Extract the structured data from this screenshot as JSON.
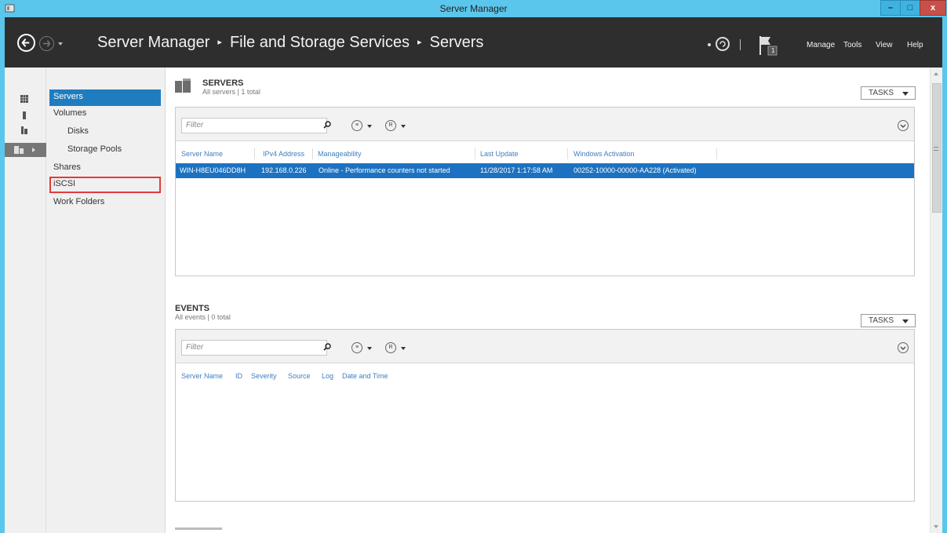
{
  "window": {
    "title": "Server Manager",
    "min_label": "–",
    "max_label": "□",
    "close_label": "x"
  },
  "header": {
    "breadcrumb": [
      "Server Manager",
      "File and Storage Services",
      "Servers"
    ],
    "separator": "▸",
    "menu": [
      "Manage",
      "Tools",
      "View",
      "Help"
    ],
    "notification_count": "1"
  },
  "sidebar": {
    "items": [
      {
        "label": "Servers",
        "state": "active"
      },
      {
        "label": "Volumes"
      },
      {
        "label": "Disks",
        "indent": true
      },
      {
        "label": "Storage Pools",
        "indent": true
      },
      {
        "label": "Shares"
      },
      {
        "label": "iSCSI",
        "state": "highlighted"
      },
      {
        "label": "Work Folders"
      }
    ]
  },
  "servers": {
    "title": "SERVERS",
    "subtitle": "All servers | 1 total",
    "tasks_label": "TASKS",
    "filter_placeholder": "Filter",
    "columns": [
      "Server Name",
      "IPv4 Address",
      "Manageability",
      "Last Update",
      "Windows Activation"
    ],
    "rows": [
      {
        "server_name": "WIN-H8EU046DD8H",
        "ipv4": "192.168.0.226",
        "manageability": "Online - Performance counters not started",
        "last_update": "11/28/2017 1:17:58 AM",
        "activation": "00252-10000-00000-AA228 (Activated)"
      }
    ]
  },
  "events": {
    "title": "EVENTS",
    "subtitle": "All events | 0 total",
    "tasks_label": "TASKS",
    "filter_placeholder": "Filter",
    "columns": [
      "Server Name",
      "ID",
      "Severity",
      "Source",
      "Log",
      "Date and Time"
    ]
  },
  "colors": {
    "titlebar": "#5bc6eb",
    "header_bg": "#2e2e2e",
    "selection": "#1c72c0",
    "highlight_border": "#e23b3b",
    "column_header": "#3f7fbf"
  },
  "icons": {
    "back": "back-arrow-icon",
    "forward": "forward-arrow-icon",
    "refresh": "refresh-icon",
    "flag": "notification-flag-icon",
    "search": "search-icon",
    "expand": "expand-chevron-icon"
  }
}
